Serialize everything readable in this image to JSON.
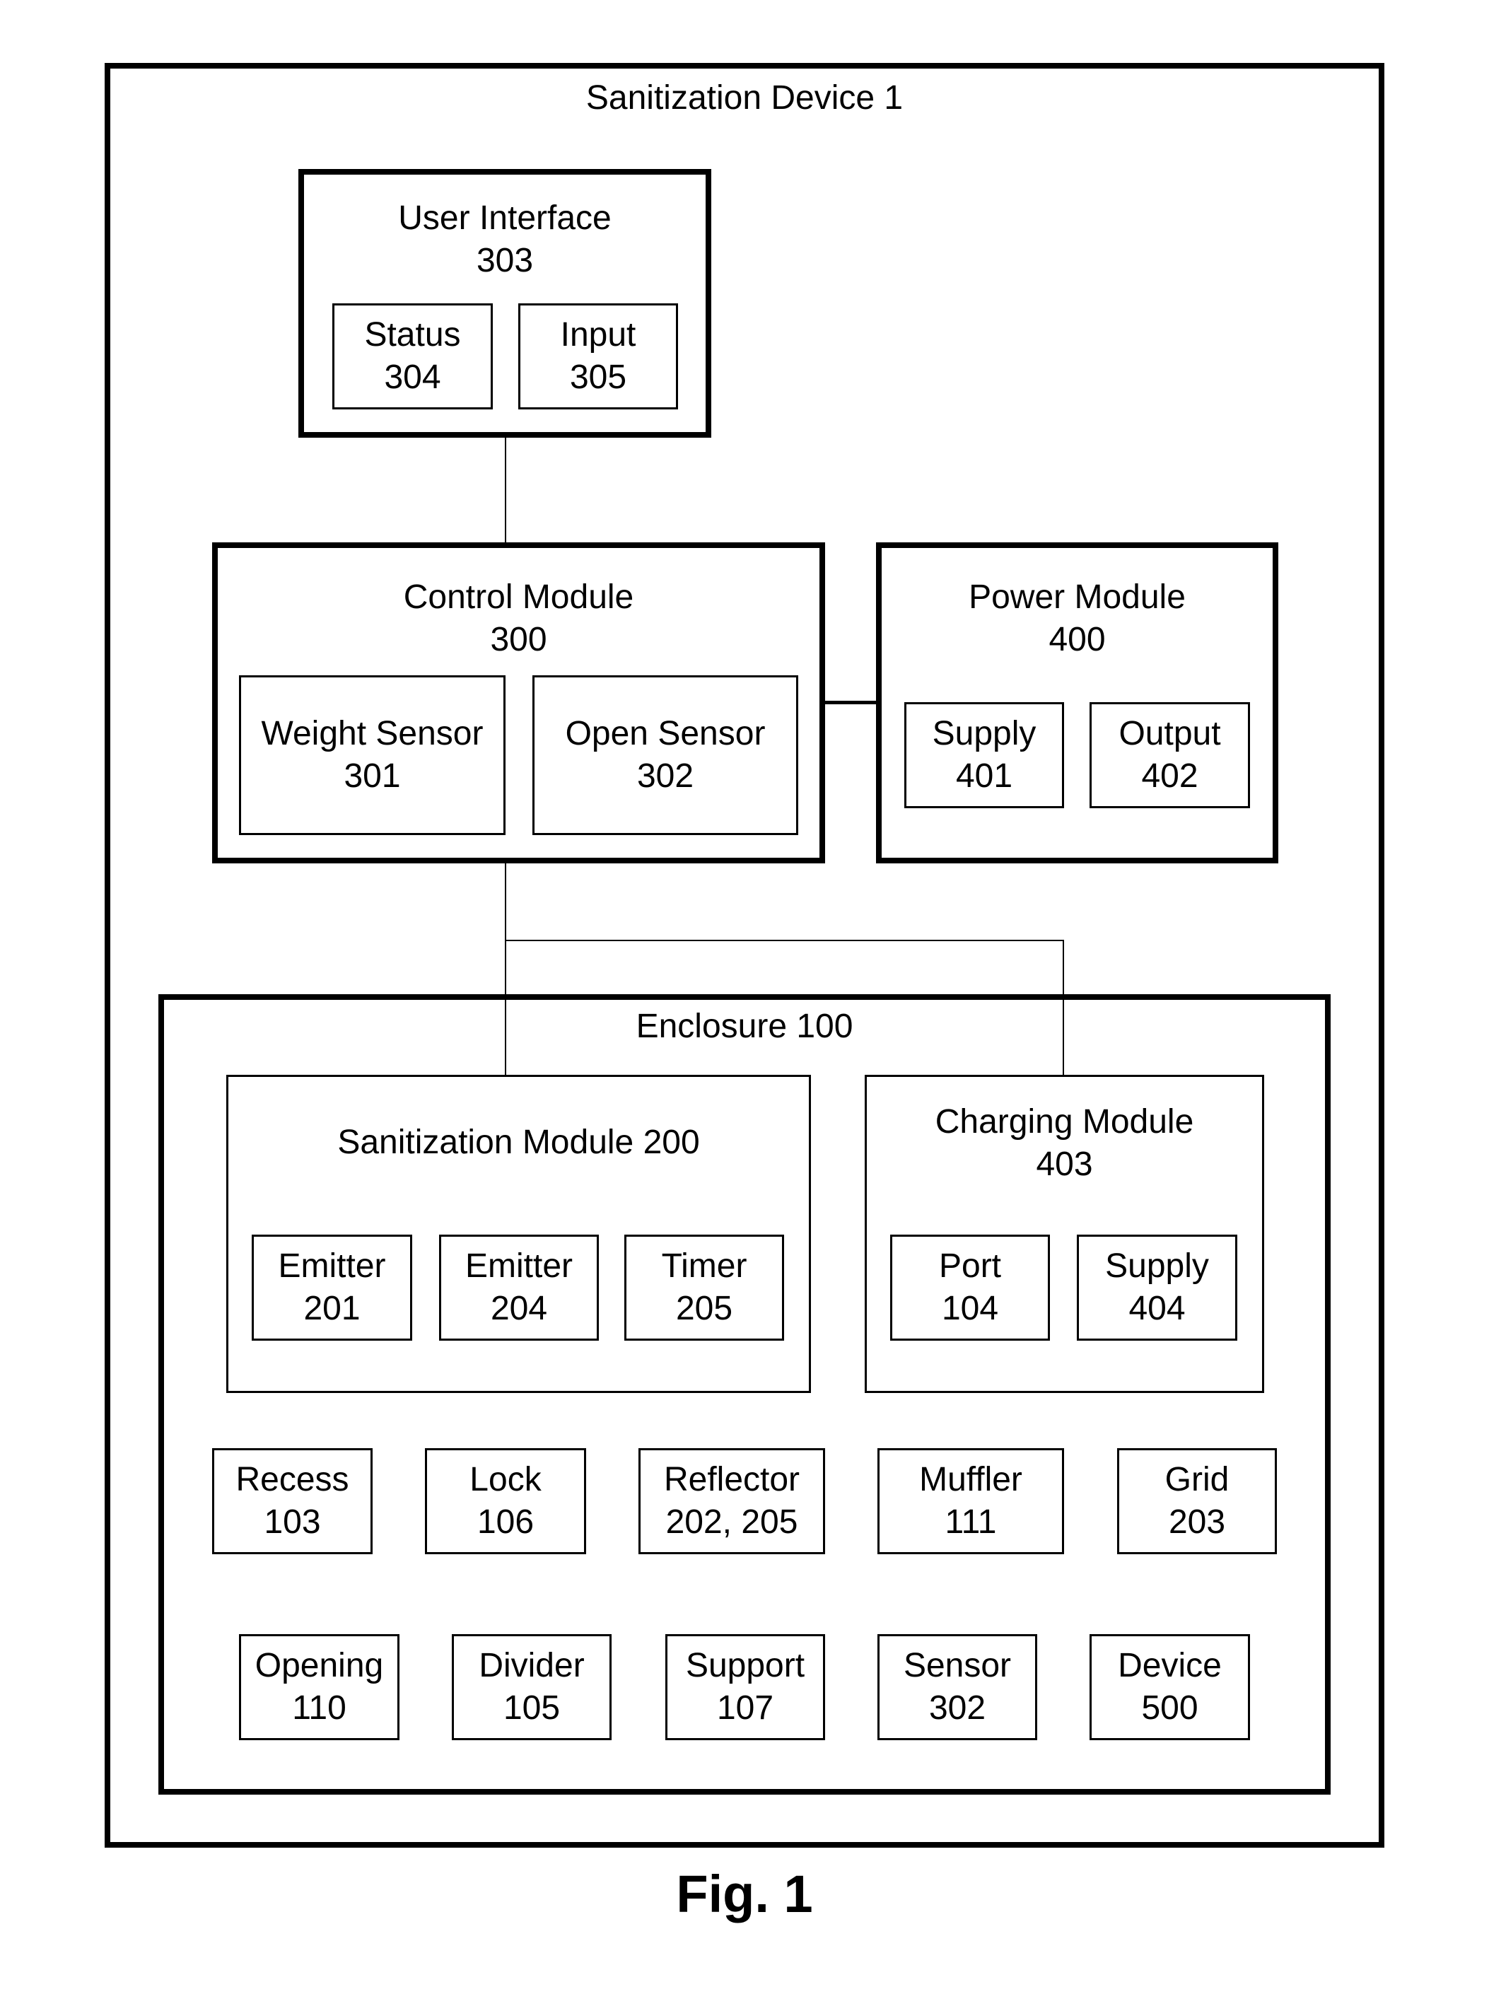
{
  "device": {
    "title": "Sanitization Device 1"
  },
  "user_interface": {
    "name": "User Interface",
    "ref": "303",
    "children": [
      {
        "name": "Status",
        "ref": "304"
      },
      {
        "name": "Input",
        "ref": "305"
      }
    ]
  },
  "control_module": {
    "name": "Control Module",
    "ref": "300",
    "children": [
      {
        "name": "Weight Sensor",
        "ref": "301"
      },
      {
        "name": "Open Sensor",
        "ref": "302"
      }
    ]
  },
  "power_module": {
    "name": "Power Module",
    "ref": "400",
    "children": [
      {
        "name": "Supply",
        "ref": "401"
      },
      {
        "name": "Output",
        "ref": "402"
      }
    ]
  },
  "enclosure": {
    "title": "Enclosure 100",
    "sanitization_module": {
      "title": "Sanitization Module 200",
      "children": [
        {
          "name": "Emitter",
          "ref": "201"
        },
        {
          "name": "Emitter",
          "ref": "204"
        },
        {
          "name": "Timer",
          "ref": "205"
        }
      ]
    },
    "charging_module": {
      "name": "Charging Module",
      "ref": "403",
      "children": [
        {
          "name": "Port",
          "ref": "104"
        },
        {
          "name": "Supply",
          "ref": "404"
        }
      ]
    },
    "row1": [
      {
        "name": "Recess",
        "ref": "103"
      },
      {
        "name": "Lock",
        "ref": "106"
      },
      {
        "name": "Reflector",
        "ref": "202, 205"
      },
      {
        "name": "Muffler",
        "ref": "111"
      },
      {
        "name": "Grid",
        "ref": "203"
      }
    ],
    "row2": [
      {
        "name": "Opening",
        "ref": "110"
      },
      {
        "name": "Divider",
        "ref": "105"
      },
      {
        "name": "Support",
        "ref": "107"
      },
      {
        "name": "Sensor",
        "ref": "302"
      },
      {
        "name": "Device",
        "ref": "500"
      }
    ]
  },
  "caption": "Fig. 1"
}
